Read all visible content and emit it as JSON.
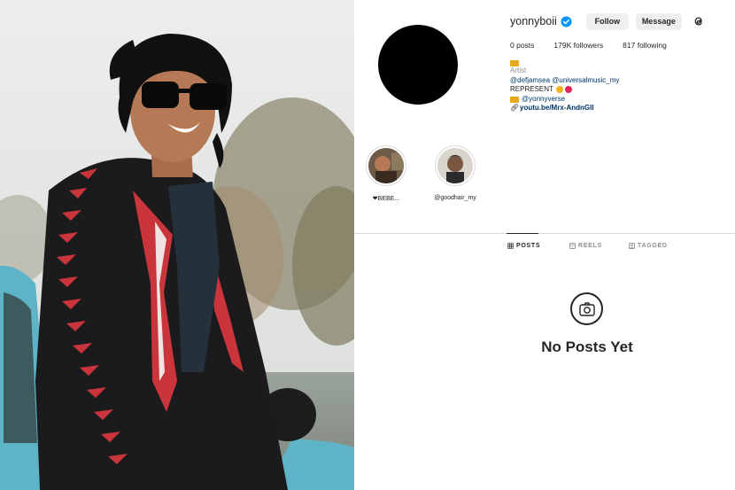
{
  "profile": {
    "username": "yonnyboii",
    "follow_label": "Follow",
    "message_label": "Message",
    "stats": {
      "posts": "0 posts",
      "followers": "179K followers",
      "following": "817 following"
    },
    "bio": {
      "category": "Artist",
      "mentions": "@defjamsea @universalmusic_my",
      "represent": "REPRESENT",
      "handle": "@yonnyverse",
      "link": "youtu.be/Mrx-AndnGII"
    }
  },
  "highlights": [
    {
      "label": "❤BEBE..."
    },
    {
      "label": "@goodhair_my"
    }
  ],
  "tabs": [
    {
      "label": "POSTS",
      "active": true
    },
    {
      "label": "REELS",
      "active": false
    },
    {
      "label": "TAGGED",
      "active": false
    }
  ],
  "empty_state": {
    "text": "No Posts Yet"
  },
  "colors": {
    "verified": "#0095f6",
    "link": "#00376b",
    "muted": "#8e8e8e"
  }
}
